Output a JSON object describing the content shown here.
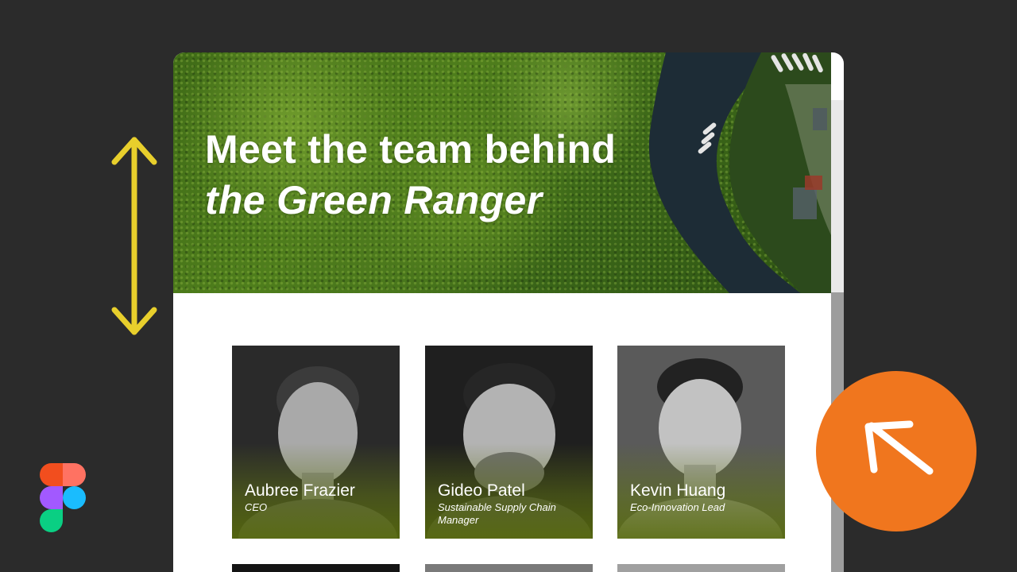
{
  "hero": {
    "title_line1": "Meet the team behind",
    "title_line2": "the Green Ranger"
  },
  "team": [
    {
      "name": "Aubree Frazier",
      "role": "CEO"
    },
    {
      "name": "Gideo Patel",
      "role": "Sustainable Supply Chain Manager"
    },
    {
      "name": "Kevin Huang",
      "role": "Eco-Innovation Lead"
    }
  ],
  "colors": {
    "background": "#2b2b2b",
    "accent_orange": "#f0761e",
    "indicator_yellow": "#e8cf2c",
    "card_tint": "#6b7d14"
  },
  "icons": {
    "resize_indicator": "vertical-double-arrow-icon",
    "cursor_button": "arrow-up-left-icon",
    "app_logo": "figma-logo"
  }
}
